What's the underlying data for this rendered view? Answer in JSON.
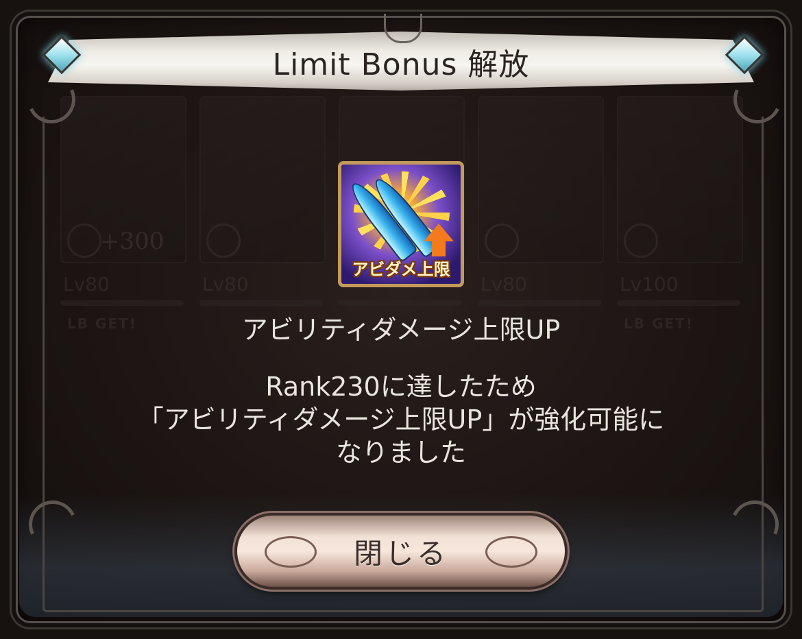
{
  "dialog": {
    "title": "Limit Bonus 解放",
    "skill_name": "アビリティダメージ上限UP",
    "message_lines": [
      "Rank230に達したため",
      "「アビリティダメージ上限UP」が強化可能に",
      "なりました"
    ],
    "close_label": "閉じる"
  },
  "skill_icon": {
    "caption": "アビダメ上限",
    "icon": "blade-burst-arrow-up-icon"
  },
  "background_cards": [
    {
      "bonus": "+300",
      "level": "Lv80",
      "status": "LB GET!"
    },
    {
      "bonus": "",
      "level": "Lv80",
      "status": ""
    },
    {
      "bonus": "",
      "level": "",
      "status": ""
    },
    {
      "bonus": "",
      "level": "Lv80",
      "status": ""
    },
    {
      "bonus": "",
      "level": "Lv100",
      "status": "LB GET!"
    }
  ],
  "colors": {
    "panel_bg": "#1c1513",
    "banner": "#f7f5f0",
    "button": "#f2e1d6",
    "text": "#e9e5df",
    "gem": "#9fe2ee"
  }
}
